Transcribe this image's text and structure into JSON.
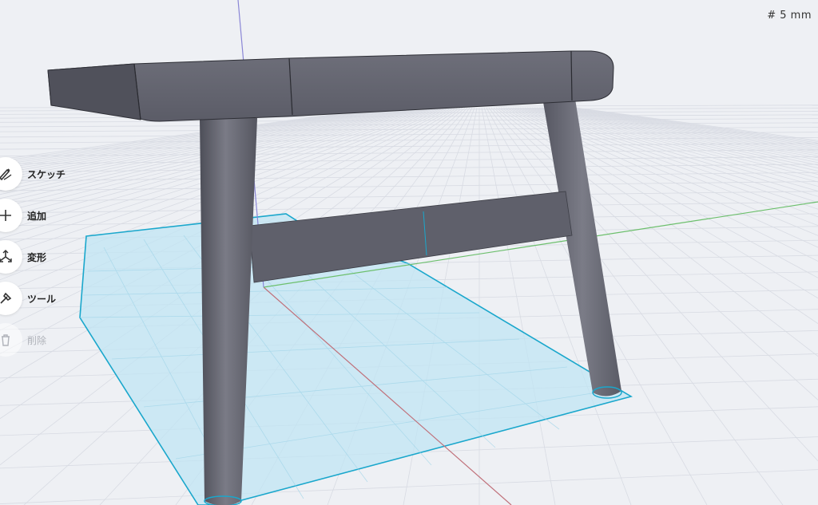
{
  "grid": {
    "label": "# 5 mm"
  },
  "toolbar": {
    "items": [
      {
        "label": "スケッチ",
        "icon": "sketch-icon",
        "enabled": true
      },
      {
        "label": "追加",
        "icon": "plus-icon",
        "enabled": true
      },
      {
        "label": "変形",
        "icon": "transform-icon",
        "enabled": true
      },
      {
        "label": "ツール",
        "icon": "tool-icon",
        "enabled": true
      },
      {
        "label": "削除",
        "icon": "trash-icon",
        "enabled": false
      }
    ]
  },
  "scene": {
    "object": "stool",
    "colors": {
      "background": "#eef0f4",
      "grid_minor": "#d7dae2",
      "grid_major": "#c6cad4",
      "selection_fill": "#bde6f5",
      "selection_stroke": "#1aa7cc",
      "axis_x": "#c0707a",
      "axis_y": "#6cbf6c",
      "axis_z": "#8a86d6",
      "body": "#646570"
    }
  }
}
